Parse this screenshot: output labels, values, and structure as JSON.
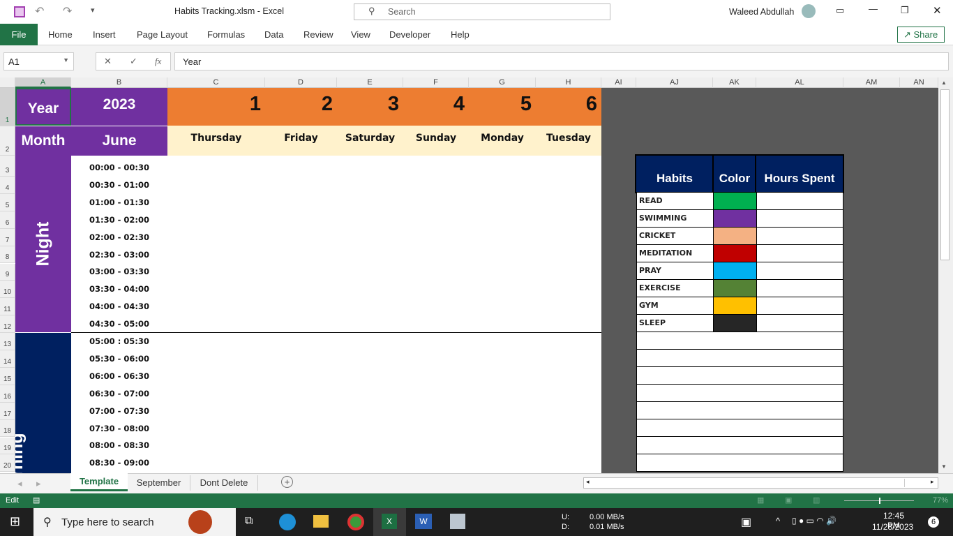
{
  "window": {
    "title": "Habits Tracking.xlsm  -  Excel",
    "search_placeholder": "Search",
    "user": "Waleed Abdullah"
  },
  "ribbon": {
    "tabs": [
      "File",
      "Home",
      "Insert",
      "Page Layout",
      "Formulas",
      "Data",
      "Review",
      "View",
      "Developer",
      "Help"
    ],
    "share": "Share"
  },
  "formula_bar": {
    "name_box": "A1",
    "value": "Year",
    "fx": "fx"
  },
  "columns": [
    "A",
    "B",
    "C",
    "D",
    "E",
    "F",
    "G",
    "H",
    "AI",
    "AJ",
    "AK",
    "AL",
    "AM",
    "AN"
  ],
  "rows": [
    "1",
    "2",
    "3",
    "4",
    "5",
    "6",
    "7",
    "8",
    "9",
    "10",
    "11",
    "12",
    "13",
    "14",
    "15",
    "16",
    "17",
    "18",
    "19",
    "20"
  ],
  "sheet": {
    "year_label": "Year",
    "year": "2023",
    "month_label": "Month",
    "month": "June",
    "days": [
      {
        "num": "1",
        "name": "Thursday"
      },
      {
        "num": "2",
        "name": "Friday"
      },
      {
        "num": "3",
        "name": "Saturday"
      },
      {
        "num": "4",
        "name": "Sunday"
      },
      {
        "num": "5",
        "name": "Monday"
      },
      {
        "num": "6",
        "name": "Tuesday"
      }
    ],
    "night_label": "Night",
    "morning_label": "Morning",
    "times": [
      "00:00 - 00:30",
      "00:30 - 01:00",
      "01:00 - 01:30",
      "01:30 - 02:00",
      "02:00 - 02:30",
      "02:30 - 03:00",
      "03:00 - 03:30",
      "03:30 - 04:00",
      "04:00 - 04:30",
      "04:30 - 05:00",
      "05:00 : 05:30",
      "05:30 - 06:00",
      "06:00 - 06:30",
      "06:30 - 07:00",
      "07:00 - 07:30",
      "07:30 - 08:00",
      "08:00 - 08:30",
      "08:30 - 09:00"
    ],
    "colors": {
      "purple": "#7030a0",
      "navy": "#002060",
      "orange": "#ed7d31",
      "cream": "#fff2cc",
      "gray": "#595959"
    }
  },
  "habits": {
    "headers": [
      "Habits",
      "Color",
      "Hours Spent"
    ],
    "items": [
      {
        "name": "READ",
        "color": "#00b050"
      },
      {
        "name": "SWIMMING",
        "color": "#7030a0"
      },
      {
        "name": "CRICKET",
        "color": "#f4b183"
      },
      {
        "name": "MEDITATION",
        "color": "#c00000"
      },
      {
        "name": "PRAY",
        "color": "#00b0f0"
      },
      {
        "name": "EXERCISE",
        "color": "#548235"
      },
      {
        "name": "GYM",
        "color": "#ffc000"
      },
      {
        "name": "SLEEP",
        "color": "#262626"
      }
    ]
  },
  "sheet_tabs": [
    "Template",
    "September",
    "Dont Delete"
  ],
  "status": {
    "mode": "Edit",
    "zoom": "77%"
  },
  "taskbar": {
    "search": "Type here to search",
    "net_u_label": "U:",
    "net_u": "0.00 MB/s",
    "net_d_label": "D:",
    "net_d": "0.01 MB/s",
    "time": "12:45 PM",
    "date": "11/28/2023",
    "notifications": "6"
  }
}
